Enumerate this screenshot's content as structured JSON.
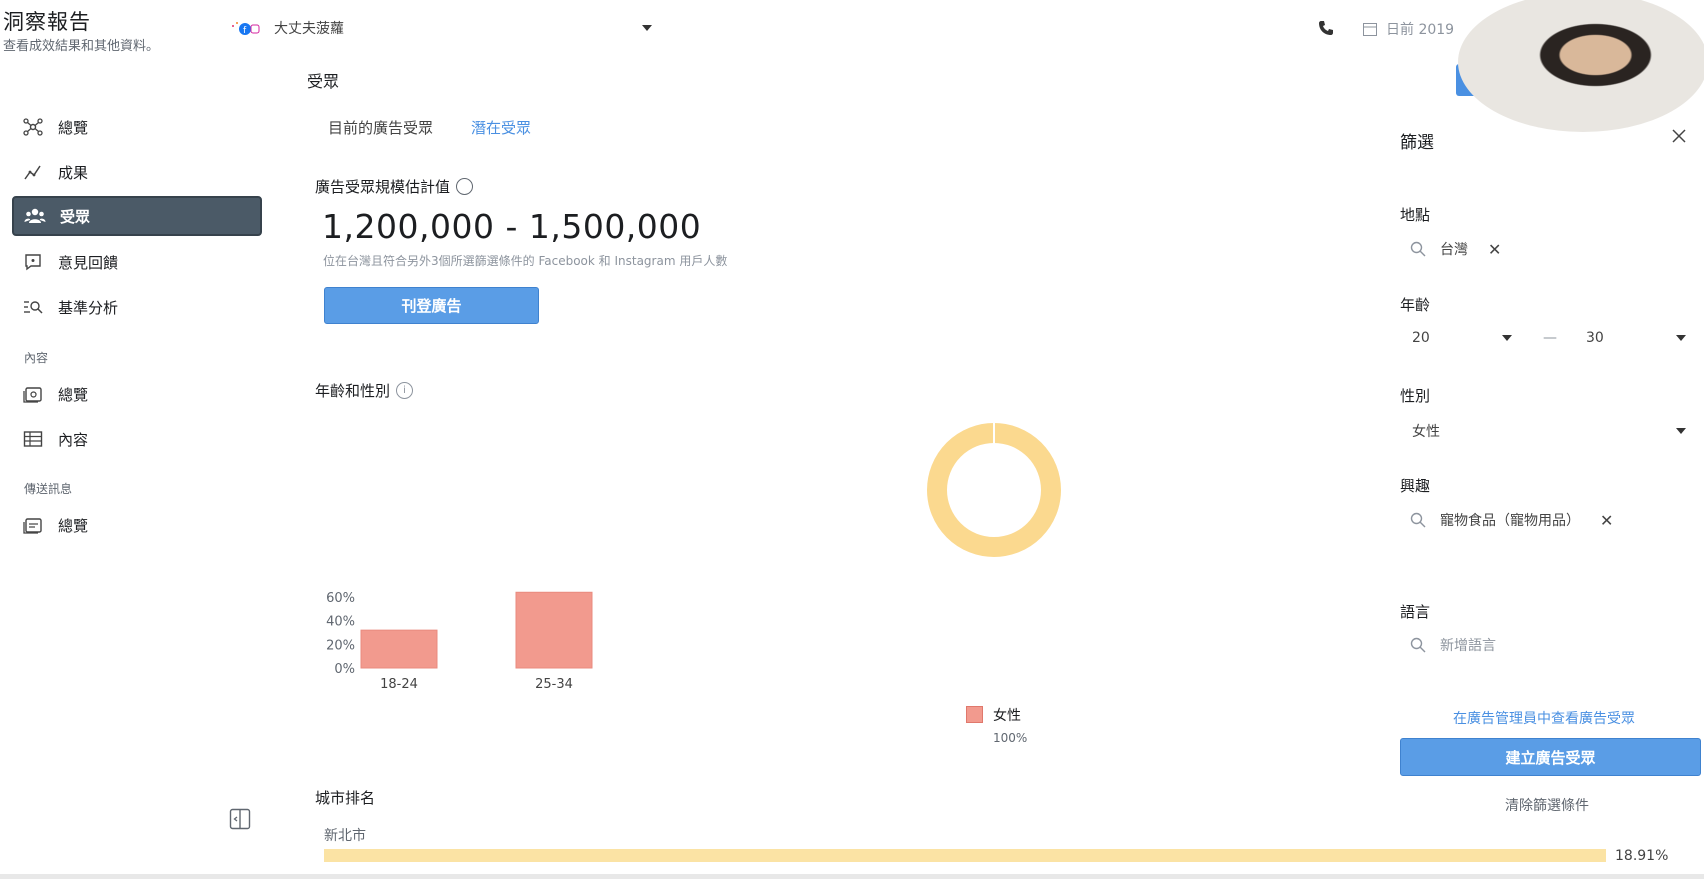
{
  "header": {
    "title": "洞察報告",
    "subtitle": "查看成效結果和其他資料。",
    "page_name": "大丈夫菠蘿",
    "date_text": "日前 2019"
  },
  "sidebar": {
    "items": [
      {
        "label": "總覽",
        "icon": "network-icon"
      },
      {
        "label": "成果",
        "icon": "trend-icon"
      },
      {
        "label": "受眾",
        "icon": "people-icon",
        "active": true
      },
      {
        "label": "意見回饋",
        "icon": "feedback-icon"
      },
      {
        "label": "基準分析",
        "icon": "benchmark-icon"
      }
    ],
    "section_content": "內容",
    "content_items": [
      {
        "label": "總覽",
        "icon": "media-icon"
      },
      {
        "label": "內容",
        "icon": "table-icon"
      }
    ],
    "section_messaging": "傳送訊息",
    "messaging_items": [
      {
        "label": "總覽",
        "icon": "media-icon"
      }
    ]
  },
  "main": {
    "section_title": "受眾",
    "tabs": [
      {
        "label": "目前的廣告受眾",
        "active": false
      },
      {
        "label": "潛在受眾",
        "active": true
      }
    ],
    "estimate_label": "廣告受眾規模估計值",
    "estimate_value": "1,200,000 - 1,500,000",
    "estimate_desc": "位在台灣且符合另外3個所選篩選條件的 Facebook 和 Instagram 用戶人數",
    "promote_button": "刊登廣告",
    "age_gender_label": "年齡和性別",
    "info_glyph": "i",
    "legend_label": "女性",
    "legend_pct": "100%",
    "city_label": "城市排名",
    "cities": [
      {
        "name": "新北市",
        "pct_text": "18.91%",
        "value": 18.91
      }
    ]
  },
  "chart_data": [
    {
      "type": "bar",
      "categories": [
        "18-24",
        "25-34"
      ],
      "series": [
        {
          "name": "女性",
          "values": [
            32,
            64
          ]
        }
      ],
      "ylim": [
        0,
        60
      ],
      "ytick_labels": [
        "60%",
        "40%",
        "20%",
        "0%"
      ],
      "color": "#f29a8e"
    },
    {
      "type": "pie",
      "labels": [
        "女性"
      ],
      "values": [
        100
      ],
      "color": "#fbd98f"
    }
  ],
  "filter": {
    "title": "篩選",
    "location_label": "地點",
    "location_value": "台灣",
    "age_label": "年齡",
    "age_from": "20",
    "age_sep": "—",
    "age_to": "30",
    "gender_label": "性別",
    "gender_value": "女性",
    "interest_label": "興趣",
    "interest_value": "寵物食品（寵物用品）",
    "language_label": "語言",
    "language_placeholder": "新增語言",
    "remove_glyph": "✕",
    "ads_manager_link": "在廣告管理員中查看廣告受眾",
    "create_button": "建立廣告受眾",
    "clear_link": "清除篩選條件"
  },
  "colors": {
    "accent": "#4a90e2",
    "active_nav": "#4b5a67",
    "bar": "#f29a8e",
    "donut": "#fbd98f"
  }
}
